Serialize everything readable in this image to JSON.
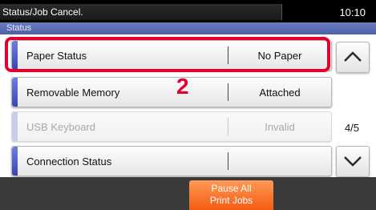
{
  "header": {
    "title": "Status/Job Cancel.",
    "clock": "10:10",
    "section": "Status"
  },
  "rows": [
    {
      "label": "Paper Status",
      "value": "No Paper",
      "enabled": true
    },
    {
      "label": "Removable Memory",
      "value": "Attached",
      "enabled": true
    },
    {
      "label": "USB Keyboard",
      "value": "Invalid",
      "enabled": false
    },
    {
      "label": "Connection Status",
      "value": "",
      "enabled": true
    }
  ],
  "pager": {
    "indicator": "4/5",
    "up_icon": "chevron-up-icon",
    "down_icon": "chevron-down-icon"
  },
  "callout": {
    "step": "2",
    "color": "#e4002b"
  },
  "footer": {
    "pause_line1": "Pause All",
    "pause_line2": "Print Jobs"
  },
  "colors": {
    "accent_bar": "#3446b6",
    "status_bar": "#5a6cb4",
    "pause_button": "#f25c12"
  }
}
